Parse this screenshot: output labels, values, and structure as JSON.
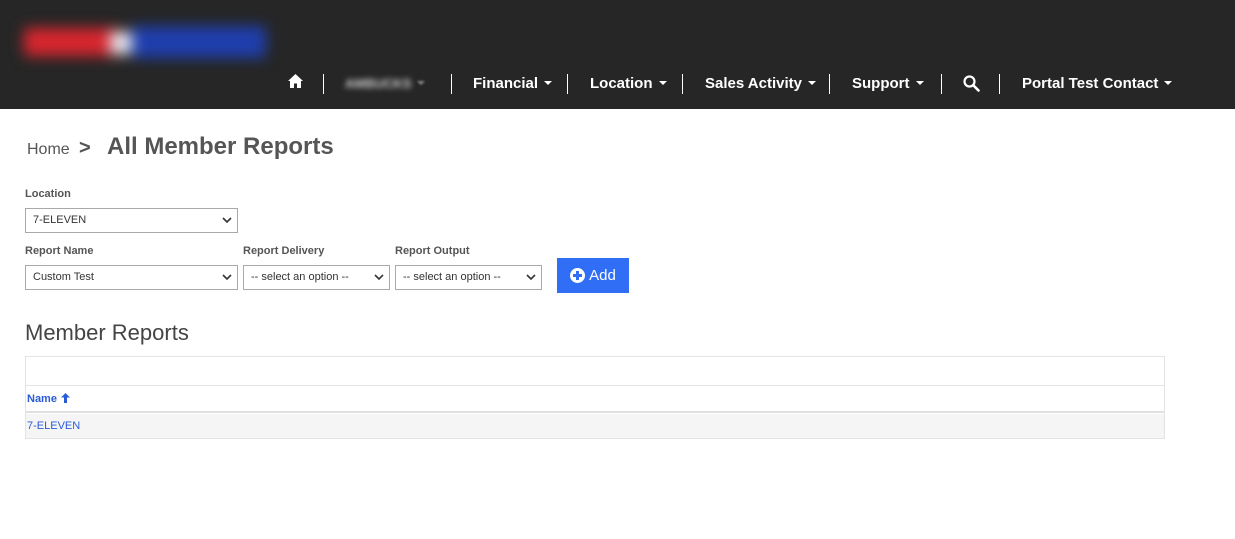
{
  "nav": {
    "account_menu": "AMBUCKS",
    "financial": "Financial",
    "location": "Location",
    "sales_activity": "Sales Activity",
    "support": "Support",
    "user": "Portal Test Contact"
  },
  "breadcrumb": {
    "home": "Home",
    "separator": ">",
    "title": "All Member Reports"
  },
  "form": {
    "location_label": "Location",
    "location_value": "7-ELEVEN",
    "report_name_label": "Report Name",
    "report_name_value": "Custom Test",
    "report_delivery_label": "Report Delivery",
    "report_delivery_value": "-- select an option --",
    "report_output_label": "Report Output",
    "report_output_value": "-- select an option --",
    "add_label": "Add"
  },
  "member_reports": {
    "title": "Member Reports",
    "columns": [
      "Name"
    ],
    "rows": [
      {
        "name": "7-ELEVEN"
      }
    ]
  },
  "colors": {
    "topbar": "#262626",
    "accent": "#2f6ef5",
    "link": "#2a5bd7"
  }
}
